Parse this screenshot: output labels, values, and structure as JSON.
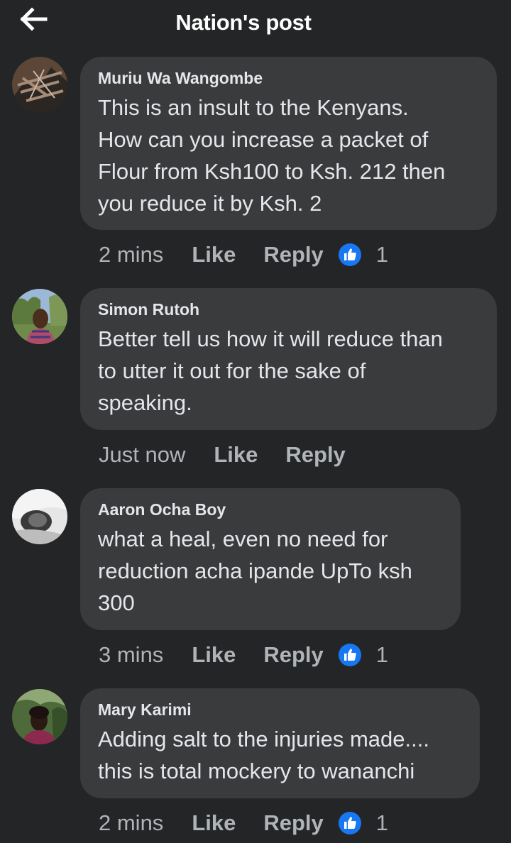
{
  "header": {
    "title": "Nation's post",
    "back_icon": "arrow-left-icon"
  },
  "colors": {
    "background": "#242526",
    "bubble": "#3a3b3c",
    "text": "#e4e6eb",
    "secondary_text": "#b0b3b8",
    "like_blue": "#1877f2"
  },
  "comments": [
    {
      "author": "Muriu Wa Wangombe",
      "text": "This is an insult to the Kenyans.\nHow can you increase a packet of\nFlour from Ksh100 to Ksh. 212 then\nyou reduce it by Ksh. 2",
      "time": "2 mins",
      "like_label": "Like",
      "reply_label": "Reply",
      "reaction_count": "1"
    },
    {
      "author": "Simon Rutoh",
      "text": "Better tell us how it will reduce than\nto utter it out for the sake of\nspeaking.",
      "time": "Just now",
      "like_label": "Like",
      "reply_label": "Reply"
    },
    {
      "author": "Aaron Ocha Boy",
      "text": "what a heal, even no need for\nreduction acha ipande UpTo ksh\n300",
      "time": "3 mins",
      "like_label": "Like",
      "reply_label": "Reply",
      "reaction_count": "1"
    },
    {
      "author": "Mary Karimi",
      "text": "Adding salt to the injuries made....\nthis is total mockery to wananchi",
      "time": "2 mins",
      "like_label": "Like",
      "reply_label": "Reply",
      "reaction_count": "1"
    }
  ]
}
